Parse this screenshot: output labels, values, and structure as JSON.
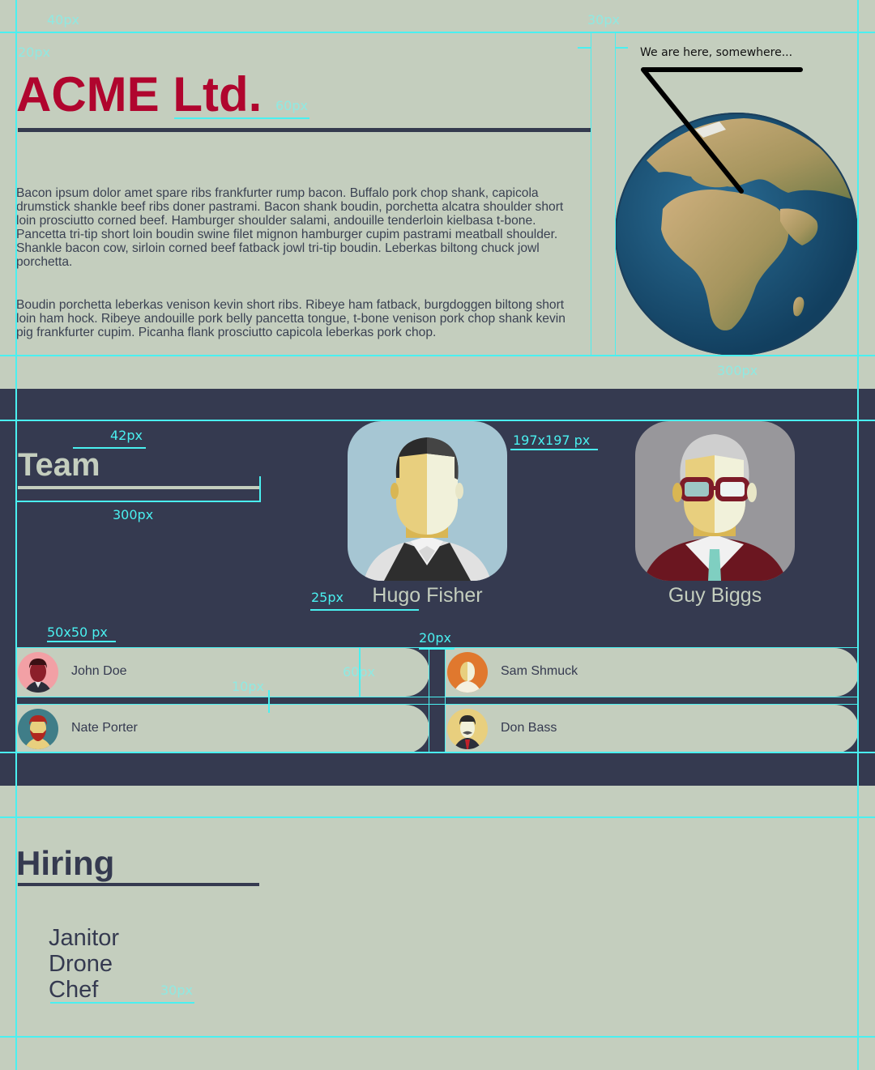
{
  "header": {
    "company": "ACME Ltd.",
    "globe_caption": "We are here, somewhere..."
  },
  "about": {
    "paragraphs": [
      "Bacon ipsum dolor amet spare ribs frankfurter rump bacon. Buffalo pork chop shank, capicola drumstick shankle beef ribs doner pastrami. Bacon shank boudin, porchetta alcatra shoulder short loin prosciutto corned beef. Hamburger shoulder salami, andouille tenderloin kielbasa t-bone. Pancetta tri-tip short loin boudin swine filet mignon hamburger cupim pastrami meatball shoulder. Shankle bacon cow, sirloin corned beef fatback jowl tri-tip boudin. Leberkas biltong chuck jowl porchetta.",
      "Boudin porchetta leberkas venison kevin short ribs. Ribeye ham fatback, burgdoggen biltong short loin ham hock. Ribeye andouille pork belly pancetta tongue, t-bone venison pork chop shank kevin pig frankfurter cupim. Picanha flank prosciutto capicola leberkas pork chop."
    ]
  },
  "team": {
    "title": "Team",
    "leads": [
      {
        "name": "Hugo Fisher",
        "icon": "avatar-man-vest-icon"
      },
      {
        "name": "Guy Biggs",
        "icon": "avatar-man-glasses-icon"
      }
    ],
    "members": [
      {
        "name": "John Doe",
        "icon": "avatar-red-man-icon"
      },
      {
        "name": "Sam Shmuck",
        "icon": "avatar-orange-man-icon"
      },
      {
        "name": "Nate Porter",
        "icon": "avatar-bearded-man-icon"
      },
      {
        "name": "Don Bass",
        "icon": "avatar-mustache-man-icon"
      }
    ]
  },
  "hiring": {
    "title": "Hiring",
    "jobs": [
      "Janitor",
      "Drone",
      "Chef"
    ]
  },
  "guides": {
    "labels": [
      "40px",
      "30px",
      "20px",
      "60px",
      "300px",
      "42px",
      "300px",
      "197x197 px",
      "25px",
      "50x50 px",
      "20px",
      "60px",
      "10px",
      "30px"
    ]
  },
  "colors": {
    "background": "#c4cebe",
    "brand": "#b0052e",
    "dark_band": "#353a50",
    "guides": "#4af0f0"
  }
}
